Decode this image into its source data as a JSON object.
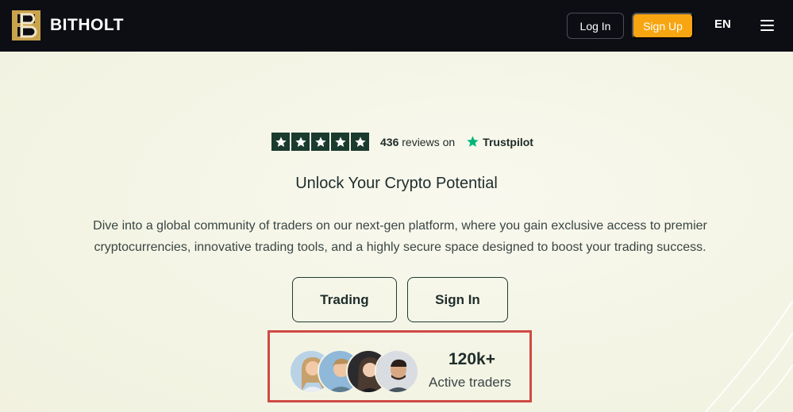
{
  "header": {
    "brand": "BITHOLT",
    "login_label": "Log In",
    "signup_label": "Sign Up",
    "language": "EN",
    "accent_color": "#f7a510",
    "background_color": "#0d0e14"
  },
  "rating": {
    "stars": 5,
    "review_count": "436",
    "reviews_text": "reviews on",
    "provider": "Trustpilot",
    "star_bg_color": "#1b3b2f",
    "provider_star_color": "#00b67a"
  },
  "hero": {
    "title": "Unlock Your Crypto Potential",
    "description": "Dive into a global community of traders on our next-gen platform, where you gain exclusive access to premier cryptocurrencies, innovative trading tools, and a highly secure space designed to boost your trading success.",
    "buttons": {
      "trading": "Trading",
      "sign_in": "Sign In"
    }
  },
  "traders": {
    "count": "120k+",
    "label": "Active traders",
    "avatar_count": 4
  }
}
